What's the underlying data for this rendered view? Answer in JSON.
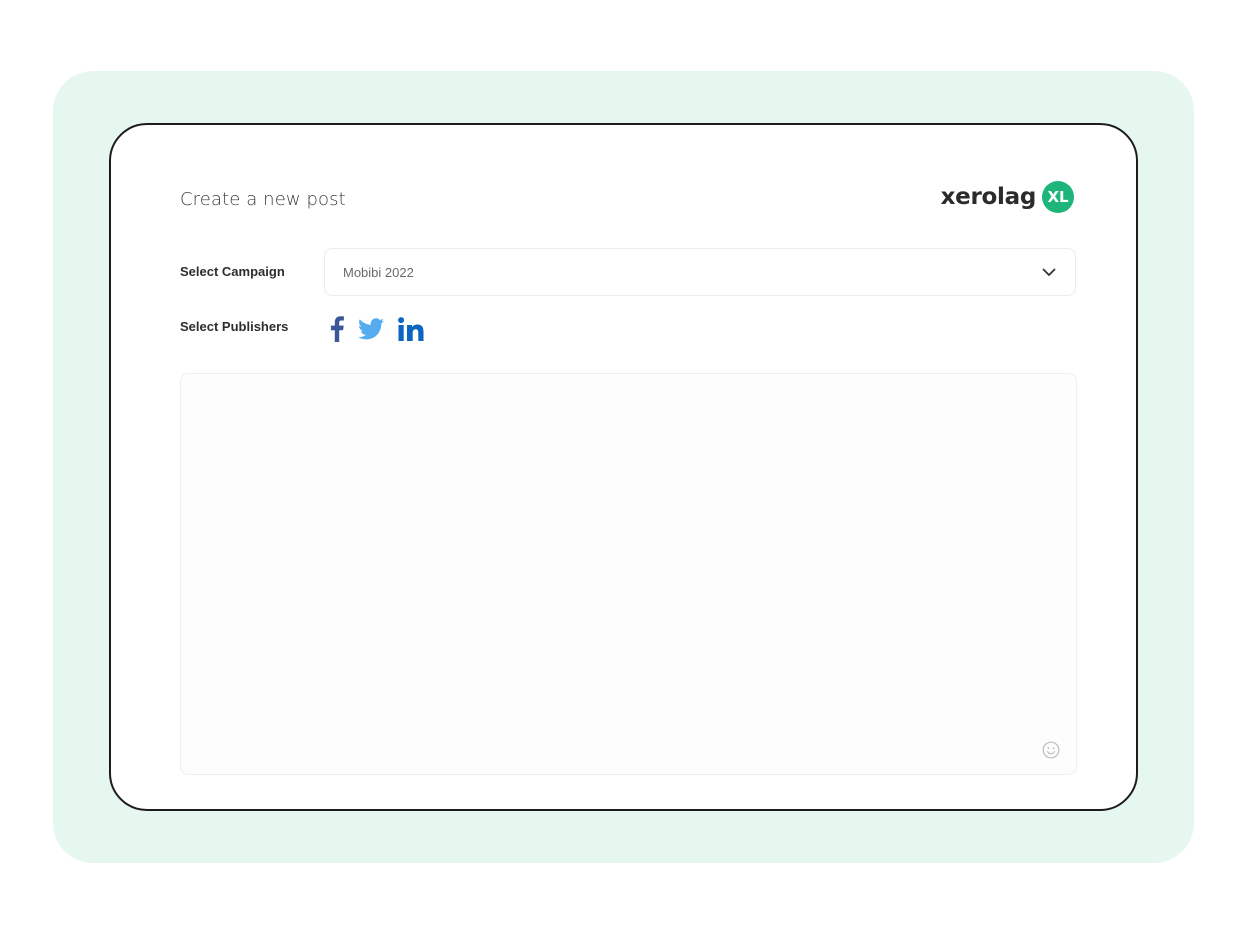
{
  "colors": {
    "backdrop": "#e6f7f0",
    "brand_green": "#1db57a",
    "facebook": "#3b5998",
    "twitter": "#55acee",
    "linkedin": "#0a66c2"
  },
  "header": {
    "title": "Create a new post",
    "logo_text": "xerolag",
    "logo_badge": "XL"
  },
  "form": {
    "campaign_label": "Select Campaign",
    "campaign_value": "Mobibi 2022",
    "publishers_label": "Select Publishers",
    "publishers": [
      {
        "icon": "facebook-icon"
      },
      {
        "icon": "twitter-icon"
      },
      {
        "icon": "linkedin-icon"
      }
    ],
    "post_text": "",
    "emoji_icon": "smiley-icon"
  }
}
